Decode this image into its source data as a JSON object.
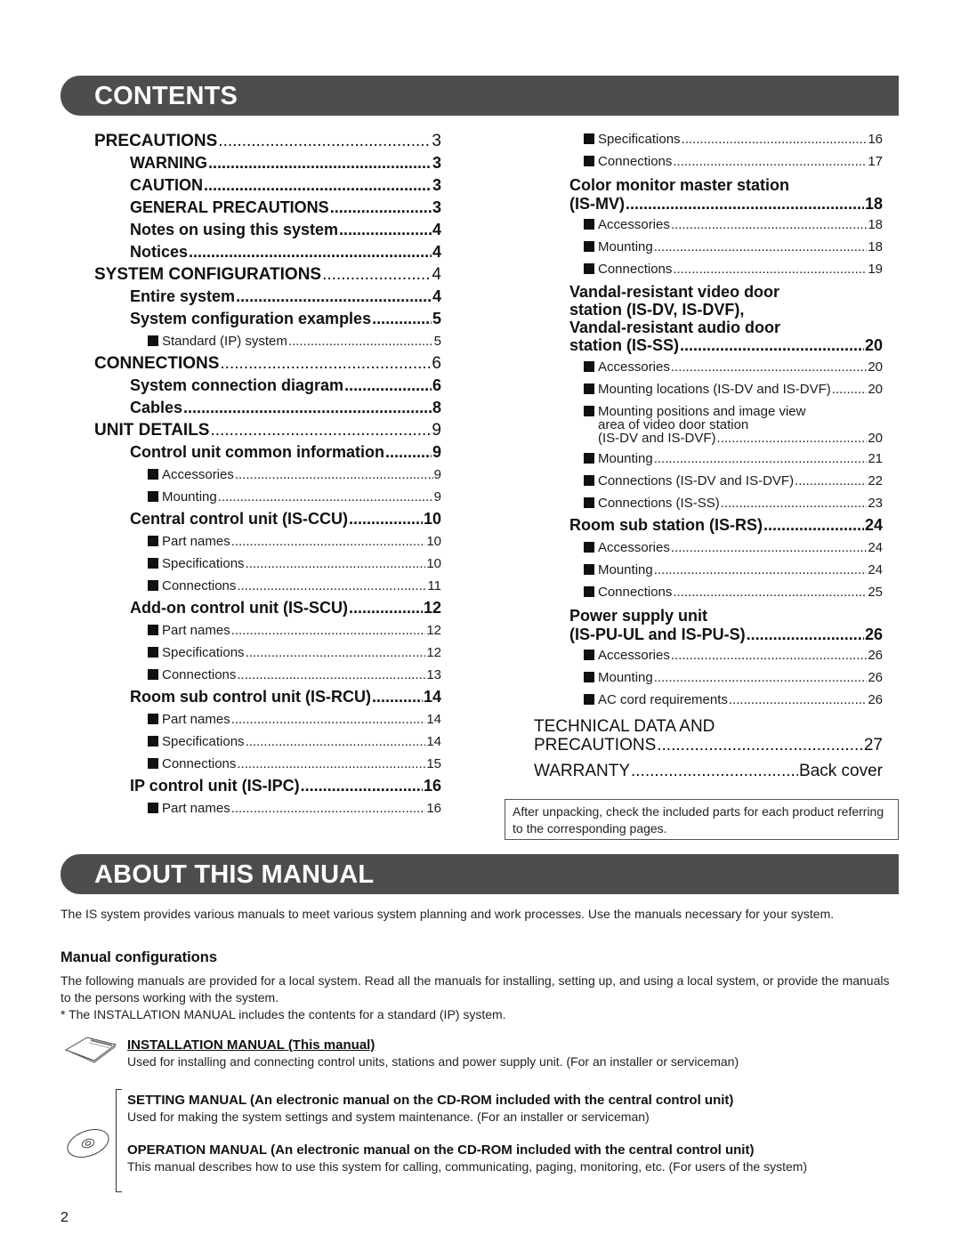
{
  "contents_title": "CONTENTS",
  "about_title": "ABOUT THIS MANUAL",
  "toc_left": [
    {
      "level": 0,
      "label": "PRECAUTIONS",
      "page": "3"
    },
    {
      "level": 1,
      "label": "WARNING",
      "page": "3"
    },
    {
      "level": 1,
      "label": "CAUTION",
      "page": "3"
    },
    {
      "level": 1,
      "label": "GENERAL PRECAUTIONS",
      "page": "3"
    },
    {
      "level": 1,
      "label": "Notes on using this system",
      "page": "4"
    },
    {
      "level": 1,
      "label": "Notices",
      "page": "4"
    },
    {
      "level": 0,
      "label": "SYSTEM CONFIGURATIONS",
      "page": "4"
    },
    {
      "level": 1,
      "label": "Entire system",
      "page": "4"
    },
    {
      "level": 1,
      "label": "System configuration examples",
      "page": "5"
    },
    {
      "level": 2,
      "label": "Standard (IP) system",
      "page": "5"
    },
    {
      "level": 0,
      "label": "CONNECTIONS",
      "page": "6"
    },
    {
      "level": 1,
      "label": "System connection diagram",
      "page": "6"
    },
    {
      "level": 1,
      "label": "Cables",
      "page": "8"
    },
    {
      "level": 0,
      "label": "UNIT DETAILS",
      "page": "9"
    },
    {
      "level": 1,
      "label": "Control unit common information",
      "page": "9"
    },
    {
      "level": 2,
      "label": "Accessories",
      "page": "9"
    },
    {
      "level": 2,
      "label": "Mounting",
      "page": "9"
    },
    {
      "level": 1,
      "label": "Central control unit (IS-CCU)",
      "page": "10"
    },
    {
      "level": 2,
      "label": "Part names",
      "page": "10"
    },
    {
      "level": 2,
      "label": "Specifications",
      "page": "10"
    },
    {
      "level": 2,
      "label": "Connections",
      "page": "11"
    },
    {
      "level": 1,
      "label": "Add-on control unit (IS-SCU)",
      "page": "12"
    },
    {
      "level": 2,
      "label": "Part names",
      "page": "12"
    },
    {
      "level": 2,
      "label": "Specifications",
      "page": "12"
    },
    {
      "level": 2,
      "label": "Connections",
      "page": "13"
    },
    {
      "level": 1,
      "label": "Room sub control unit (IS-RCU)",
      "page": "14"
    },
    {
      "level": 2,
      "label": "Part names",
      "page": "14"
    },
    {
      "level": 2,
      "label": "Specifications",
      "page": "14"
    },
    {
      "level": 2,
      "label": "Connections",
      "page": "15"
    },
    {
      "level": 1,
      "label": "IP control unit (IS-IPC)",
      "page": "16"
    },
    {
      "level": 2,
      "label": "Part names",
      "page": "16"
    }
  ],
  "toc_right": {
    "ipc_cont": [
      {
        "label": "Specifications",
        "page": "16"
      },
      {
        "label": "Connections",
        "page": "17"
      }
    ],
    "mv_title_line1": "Color monitor master station",
    "mv_title_line2": "(IS-MV)",
    "mv_page": "18",
    "mv_items": [
      {
        "label": "Accessories",
        "page": "18"
      },
      {
        "label": "Mounting",
        "page": "18"
      },
      {
        "label": "Connections",
        "page": "19"
      }
    ],
    "dv_title_line1": "Vandal-resistant video door",
    "dv_title_line2": "station (IS-DV, IS-DVF),",
    "dv_title_line3": "Vandal-resistant audio door",
    "dv_title_line4": "station (IS-SS)",
    "dv_page": "20",
    "dv_items_a": [
      {
        "label": "Accessories",
        "page": "20"
      },
      {
        "label": "Mounting locations (IS-DV and IS-DVF)",
        "page": "20"
      }
    ],
    "dv_multi_line1": "Mounting positions and image view",
    "dv_multi_line2": "area of video door station",
    "dv_multi_line3": "(IS-DV and IS-DVF)",
    "dv_multi_page": "20",
    "dv_items_b": [
      {
        "label": "Mounting",
        "page": "21"
      },
      {
        "label": "Connections (IS-DV and IS-DVF)",
        "page": "22"
      },
      {
        "label": "Connections (IS-SS)",
        "page": "23"
      }
    ],
    "rs_title": "Room sub station (IS-RS)",
    "rs_page": "24",
    "rs_items": [
      {
        "label": "Accessories",
        "page": "24"
      },
      {
        "label": "Mounting",
        "page": "24"
      },
      {
        "label": "Connections",
        "page": "25"
      }
    ],
    "pu_title_line1": "Power supply unit",
    "pu_title_line2": "(IS-PU-UL and IS-PU-S)",
    "pu_page": "26",
    "pu_items": [
      {
        "label": "Accessories",
        "page": "26"
      },
      {
        "label": "Mounting",
        "page": "26"
      },
      {
        "label": "AC cord requirements",
        "page": "26"
      }
    ],
    "tech_line1": "TECHNICAL DATA AND",
    "tech_line2": "PRECAUTIONS",
    "tech_page": "27",
    "warranty_label": "WARRANTY",
    "warranty_page": "Back cover"
  },
  "note_box": "After unpacking, check the included parts for each product referring to the corresponding pages.",
  "about": {
    "intro": "The IS system provides various manuals to meet various system planning and work processes. Use the manuals necessary for your system.",
    "config_heading": "Manual configurations",
    "config_text": "The following manuals are provided for a local system. Read all the manuals for installing, setting up, and using a local system, or provide the manuals to the persons working with the system.",
    "config_note": "* The INSTALLATION MANUAL includes the contents for a standard (IP) system.",
    "manuals": [
      {
        "title": "INSTALLATION MANUAL (This manual)",
        "desc": "Used for installing and connecting control units, stations and power supply unit. (For an installer or serviceman)"
      },
      {
        "title": "SETTING MANUAL (An electronic manual on the CD-ROM included with the central control unit)",
        "desc": "Used for making the system settings and system maintenance. (For an installer or serviceman)"
      },
      {
        "title": "OPERATION MANUAL (An electronic manual on the CD-ROM included with the central control unit)",
        "desc": "This manual describes how to use this system for calling, communicating, paging, monitoring, etc. (For users of the system)"
      }
    ]
  },
  "page_number": "2",
  "colors": {
    "banner": "#4d4d4d",
    "text": "#111111"
  }
}
